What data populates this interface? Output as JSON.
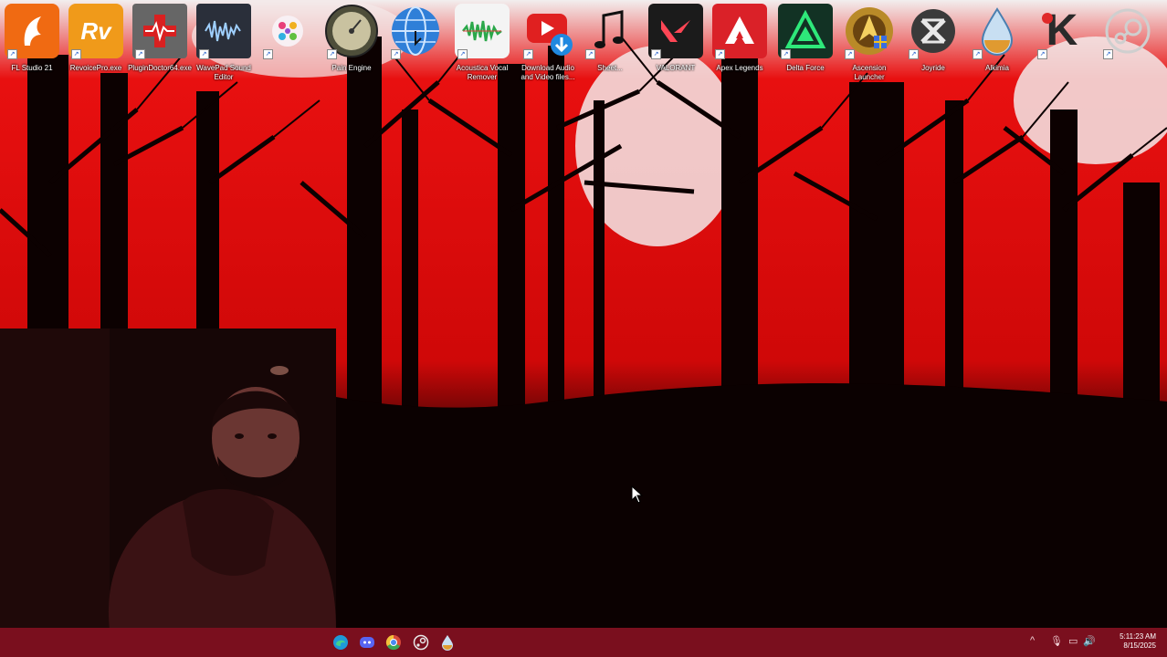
{
  "desktop": {
    "icons": [
      {
        "label": "FL Studio 21",
        "icon": "fl-studio-icon"
      },
      {
        "label": "RevoicePro.exe",
        "icon": "revoice-pro-icon",
        "glyph": "Rv"
      },
      {
        "label": "PluginDoctor64.exe",
        "icon": "plugin-doctor-icon"
      },
      {
        "label": "WavePad Sound\nEditor",
        "icon": "wavepad-icon"
      },
      {
        "label": "",
        "icon": "colorful-circle-icon"
      },
      {
        "label": "Pain Engine",
        "icon": "pain-engine-icon"
      },
      {
        "label": "",
        "icon": "globe-icon"
      },
      {
        "label": "Acoustica Vocal\nRemover",
        "icon": "vocal-remover-icon"
      },
      {
        "label": "Download Audio\nand Video files...",
        "icon": "download-audio-video-icon"
      },
      {
        "label": "Sheet...",
        "icon": "music-notes-icon"
      },
      {
        "label": "VALORANT",
        "icon": "valorant-icon"
      },
      {
        "label": "Apex Legends",
        "icon": "apex-legends-icon"
      },
      {
        "label": "Delta Force",
        "icon": "delta-force-icon"
      },
      {
        "label": "Ascension\nLauncher",
        "icon": "ascension-launcher-icon"
      },
      {
        "label": "Joyride",
        "icon": "joyride-icon"
      },
      {
        "label": "Alkimia",
        "icon": "water-drop-icon"
      },
      {
        "label": "",
        "icon": "kick-icon",
        "glyph": "K"
      },
      {
        "label": "",
        "icon": "steam-icon"
      }
    ]
  },
  "taskbar": {
    "icons": [
      "edge-icon",
      "discord-icon",
      "chrome-icon",
      "steam-icon",
      "water-drop-icon"
    ],
    "tray": {
      "chevron": "^",
      "mic": "🎙",
      "network": "▭",
      "volume": "🔊"
    },
    "clock": {
      "time": "5:11:23 AM",
      "date": "8/15/2025"
    }
  },
  "colors": {
    "wallpaper_red": "#e10a0a",
    "taskbar": "#7a0f1e"
  }
}
